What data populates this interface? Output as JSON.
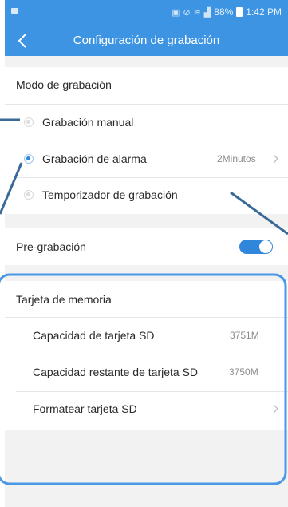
{
  "status_bar": {
    "battery": "88%",
    "time": "1:42 PM"
  },
  "app_bar": {
    "title": "Configuración de grabación"
  },
  "recording_mode": {
    "header": "Modo de grabación",
    "options": [
      {
        "label": "Grabación manual",
        "selected": false
      },
      {
        "label": "Grabación de alarma",
        "selected": true,
        "value": "2Minutos"
      },
      {
        "label": "Temporizador de grabación",
        "selected": false
      }
    ]
  },
  "pre_recording": {
    "label": "Pre-grabación",
    "enabled": true
  },
  "memory_card": {
    "header": "Tarjeta de memoria",
    "items": [
      {
        "label": "Capacidad de tarjeta SD",
        "value": "3751M"
      },
      {
        "label": "Capacidad restante de tarjeta SD",
        "value": "3750M"
      },
      {
        "label": "Formatear tarjeta SD"
      }
    ]
  },
  "colors": {
    "accent": "#3c94e3",
    "annotation": "#3a6a96",
    "highlight_box": "#4a98e6"
  }
}
